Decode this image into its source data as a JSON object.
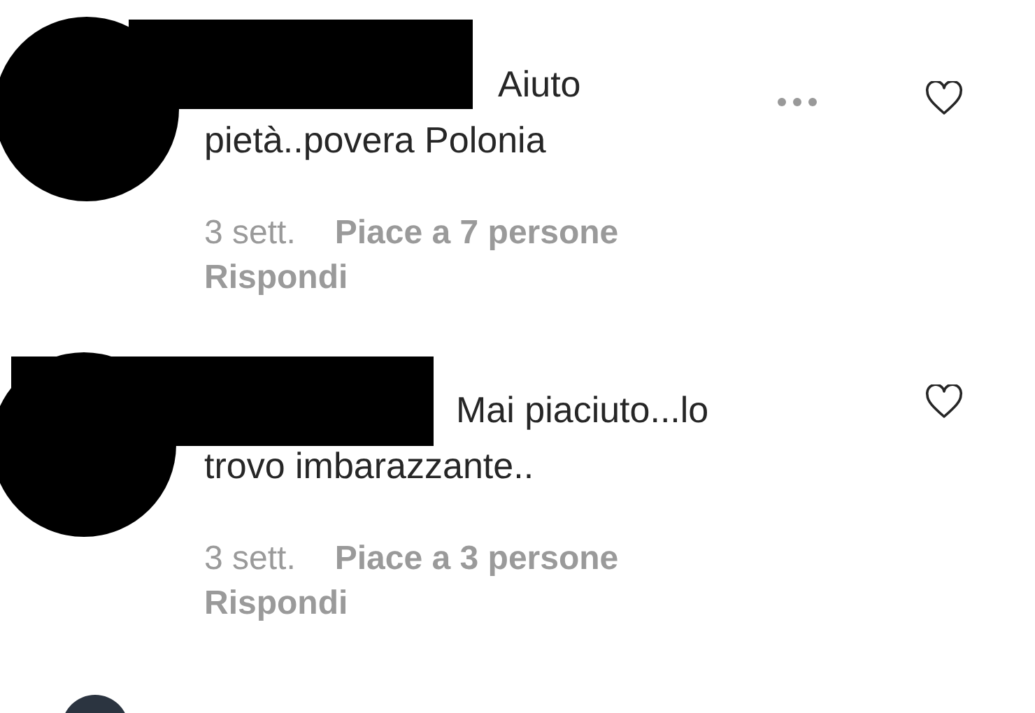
{
  "comments": [
    {
      "redacted": true,
      "text": "Aiuto pietà..povera Polonia",
      "time": "3 sett.",
      "likes": "Piace a 7 persone",
      "reply": "Rispondi",
      "more_options": true,
      "liked": false
    },
    {
      "redacted": true,
      "text": "Mai piaciuto...lo trovo imbarazzante..",
      "time": "3 sett.",
      "likes": "Piace a 3 persone",
      "reply": "Rispondi",
      "more_options": false,
      "liked": false
    }
  ]
}
